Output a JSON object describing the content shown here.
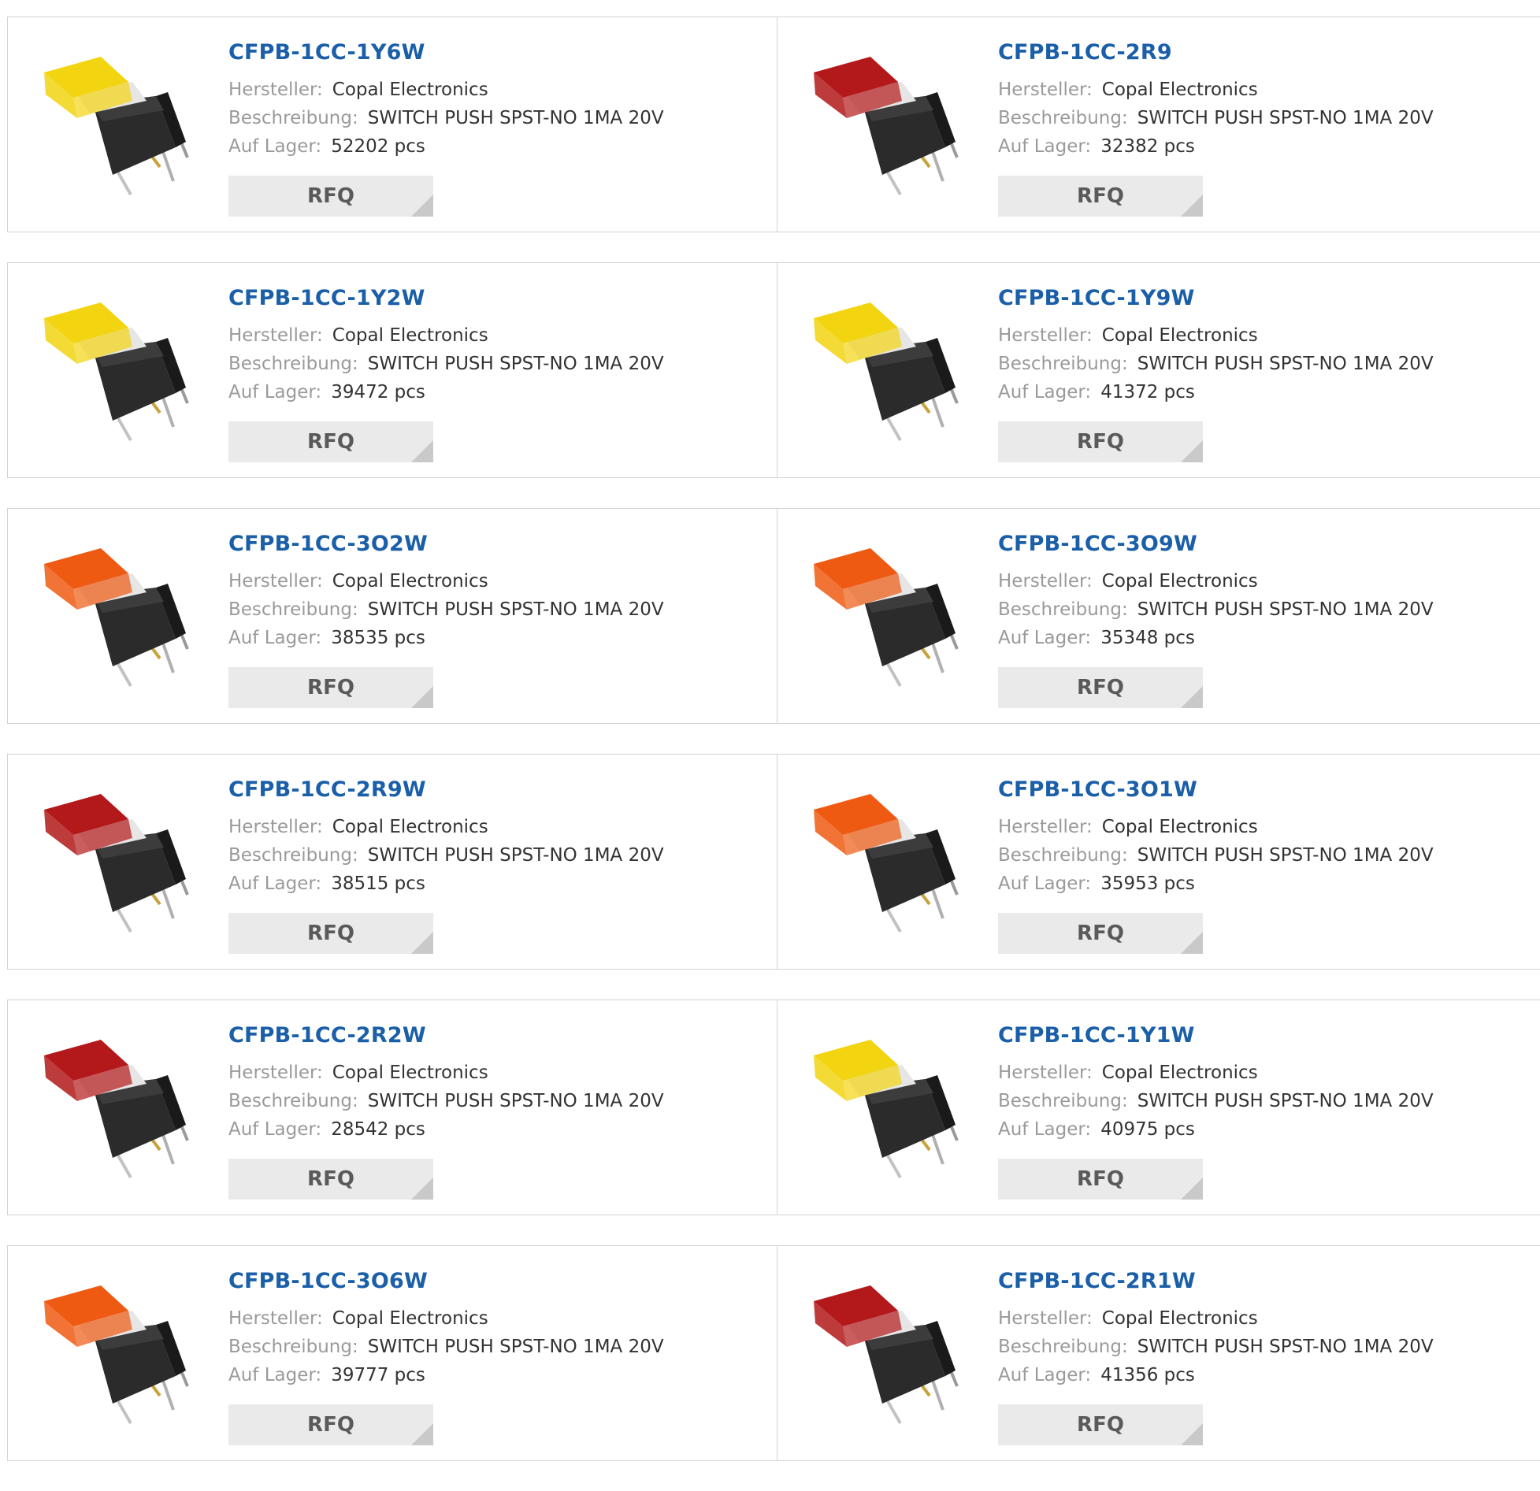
{
  "labels": {
    "manufacturer": "Hersteller:",
    "description": "Beschreibung:",
    "stock": "Auf Lager:",
    "rfq": "RFQ"
  },
  "colors": {
    "title": "#1a5fa8",
    "yellow": "#f2d411",
    "red": "#b3191a",
    "orange": "#ee5a12"
  },
  "products": [
    {
      "part": "CFPB-1CC-1Y6W",
      "manufacturer": "Copal Electronics",
      "description": "SWITCH PUSH SPST-NO 1MA 20V",
      "stock": "52202 pcs",
      "cap_color": "yellow",
      "icon": "push-switch-yellow-icon"
    },
    {
      "part": "CFPB-1CC-2R9",
      "manufacturer": "Copal Electronics",
      "description": "SWITCH PUSH SPST-NO 1MA 20V",
      "stock": "32382 pcs",
      "cap_color": "red",
      "icon": "push-switch-red-icon"
    },
    {
      "part": "CFPB-1CC-1Y2W",
      "manufacturer": "Copal Electronics",
      "description": "SWITCH PUSH SPST-NO 1MA 20V",
      "stock": "39472 pcs",
      "cap_color": "yellow",
      "icon": "push-switch-yellow-icon"
    },
    {
      "part": "CFPB-1CC-1Y9W",
      "manufacturer": "Copal Electronics",
      "description": "SWITCH PUSH SPST-NO 1MA 20V",
      "stock": "41372 pcs",
      "cap_color": "yellow",
      "icon": "push-switch-yellow-icon"
    },
    {
      "part": "CFPB-1CC-3O2W",
      "manufacturer": "Copal Electronics",
      "description": "SWITCH PUSH SPST-NO 1MA 20V",
      "stock": "38535 pcs",
      "cap_color": "orange",
      "icon": "push-switch-orange-icon"
    },
    {
      "part": "CFPB-1CC-3O9W",
      "manufacturer": "Copal Electronics",
      "description": "SWITCH PUSH SPST-NO 1MA 20V",
      "stock": "35348 pcs",
      "cap_color": "orange",
      "icon": "push-switch-orange-icon"
    },
    {
      "part": "CFPB-1CC-2R9W",
      "manufacturer": "Copal Electronics",
      "description": "SWITCH PUSH SPST-NO 1MA 20V",
      "stock": "38515 pcs",
      "cap_color": "red",
      "icon": "push-switch-red-icon"
    },
    {
      "part": "CFPB-1CC-3O1W",
      "manufacturer": "Copal Electronics",
      "description": "SWITCH PUSH SPST-NO 1MA 20V",
      "stock": "35953 pcs",
      "cap_color": "orange",
      "icon": "push-switch-orange-icon"
    },
    {
      "part": "CFPB-1CC-2R2W",
      "manufacturer": "Copal Electronics",
      "description": "SWITCH PUSH SPST-NO 1MA 20V",
      "stock": "28542 pcs",
      "cap_color": "red",
      "icon": "push-switch-red-icon"
    },
    {
      "part": "CFPB-1CC-1Y1W",
      "manufacturer": "Copal Electronics",
      "description": "SWITCH PUSH SPST-NO 1MA 20V",
      "stock": "40975 pcs",
      "cap_color": "yellow",
      "icon": "push-switch-yellow-icon"
    },
    {
      "part": "CFPB-1CC-3O6W",
      "manufacturer": "Copal Electronics",
      "description": "SWITCH PUSH SPST-NO 1MA 20V",
      "stock": "39777 pcs",
      "cap_color": "orange",
      "icon": "push-switch-orange-icon"
    },
    {
      "part": "CFPB-1CC-2R1W",
      "manufacturer": "Copal Electronics",
      "description": "SWITCH PUSH SPST-NO 1MA 20V",
      "stock": "41356 pcs",
      "cap_color": "red",
      "icon": "push-switch-red-icon"
    }
  ]
}
